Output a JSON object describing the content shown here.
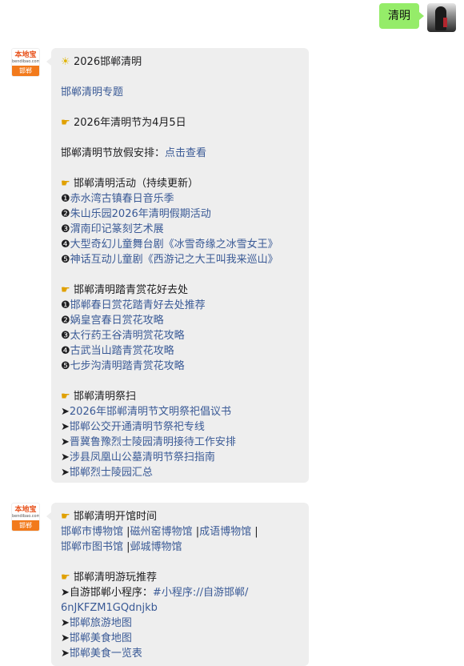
{
  "user": {
    "message": "清明"
  },
  "bot": {
    "brand": "本地宝",
    "domain": "bendibao.com",
    "city": "邯郸"
  },
  "msg1": {
    "title_icon": "sun-icon",
    "title": "2026邯郸清明",
    "topic_link": "邯郸清明专题",
    "date_line": "2026年清明节为4月5日",
    "holiday_prefix": "邯郸清明节放假安排：",
    "holiday_link": "点击查看",
    "activities_title": "邯郸清明活动（持续更新）",
    "activities": [
      {
        "num": "❶",
        "text": "赤水湾古镇春日音乐季"
      },
      {
        "num": "❷",
        "text": "朱山乐园2026年清明假期活动"
      },
      {
        "num": "❸",
        "text": "渭南印记篆刻艺术展"
      },
      {
        "num": "❹",
        "text": "大型奇幻儿童舞台剧《冰雪奇缘之冰雪女王》"
      },
      {
        "num": "❺",
        "text": "神话互动儿童剧《西游记之大王叫我来巡山》"
      }
    ],
    "spring_title": "邯郸清明踏青赏花好去处",
    "spring": [
      {
        "num": "❶",
        "text": "邯郸春日赏花踏青好去处推荐"
      },
      {
        "num": "❷",
        "text": "娲皇宫春日赏花攻略"
      },
      {
        "num": "❸",
        "text": "太行药王谷清明赏花攻略"
      },
      {
        "num": "❹",
        "text": "古武当山踏青赏花攻略"
      },
      {
        "num": "❺",
        "text": "七步沟清明踏青赏花攻略"
      }
    ],
    "sweep_title": "邯郸清明祭扫",
    "sweep": [
      {
        "arrow": "➤",
        "text": "2026年邯郸清明节文明祭祀倡议书"
      },
      {
        "arrow": "➤",
        "text": "邯郸公交开通清明节祭祀专线"
      },
      {
        "arrow": "➤",
        "text": "晋冀鲁豫烈士陵园清明接待工作安排"
      },
      {
        "arrow": "➤",
        "text": "涉县凤凰山公墓清明节祭扫指南"
      },
      {
        "arrow": "➤",
        "text": "邯郸烈士陵园汇总"
      }
    ]
  },
  "msg2": {
    "museum_title": "邯郸清明开馆时间",
    "museum_links": [
      "邯郸市博物馆",
      "磁州窑博物馆",
      "成语博物馆",
      "邯郸市图书馆",
      "邺城博物馆"
    ],
    "separator": "|",
    "rec_title": "邯郸清明游玩推荐",
    "mini_prefix": "自游邯郸小程序：",
    "mini_link_1": "#小程序://自游邯郸/",
    "mini_link_2": "6nJKFZM1GQdnjkb",
    "rec": [
      {
        "arrow": "➤",
        "text": "邯郸旅游地图"
      },
      {
        "arrow": "➤",
        "text": "邯郸美食地图"
      },
      {
        "arrow": "➤",
        "text": "邯郸美食一览表"
      }
    ]
  },
  "icons": {
    "sun": "☀",
    "hand": "☛",
    "arrow": "➤"
  }
}
